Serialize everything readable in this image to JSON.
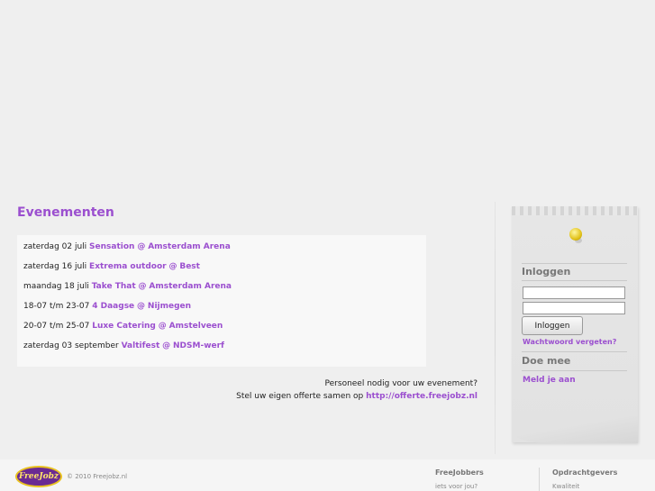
{
  "main": {
    "title": "Evenementen",
    "events": [
      {
        "date": "zaterdag 02 juli",
        "name": "Sensation",
        "venue": "Amsterdam Arena"
      },
      {
        "date": "zaterdag 16 juli",
        "name": "Extrema outdoor",
        "venue": "Best"
      },
      {
        "date": "maandag 18 juli",
        "name": "Take That",
        "venue": "Amsterdam Arena"
      },
      {
        "date": "18-07 t/m 23-07",
        "name": "4 Daagse",
        "venue": "Nijmegen"
      },
      {
        "date": "20-07 t/m 25-07",
        "name": "Luxe Catering",
        "venue": "Amstelveen"
      },
      {
        "date": "zaterdag 03 september",
        "name": "Valtifest",
        "venue": "NDSM-werf"
      }
    ],
    "at_symbol": "@",
    "personnel_line1": "Personeel nodig voor uw evenement?",
    "personnel_line2": "Stel uw eigen offerte samen op",
    "personnel_link": "http://offerte.freejobz.nl"
  },
  "sidebar": {
    "login_title": "Inloggen",
    "login_button": "Inloggen",
    "forgot_link": "Wachtwoord vergeten?",
    "join_title": "Doe mee",
    "join_link": "Meld je aan"
  },
  "footer": {
    "logo_text": "FreeJobz",
    "copyright": "© 2010 Freejobz.nl",
    "col1_title": "FreeJobbers",
    "col1_link": "iets voor jou?",
    "col2_title": "Opdrachtgevers",
    "col2_link": "Kwaliteit"
  },
  "colors": {
    "accent": "#9b4fcf",
    "background": "#efefef"
  }
}
